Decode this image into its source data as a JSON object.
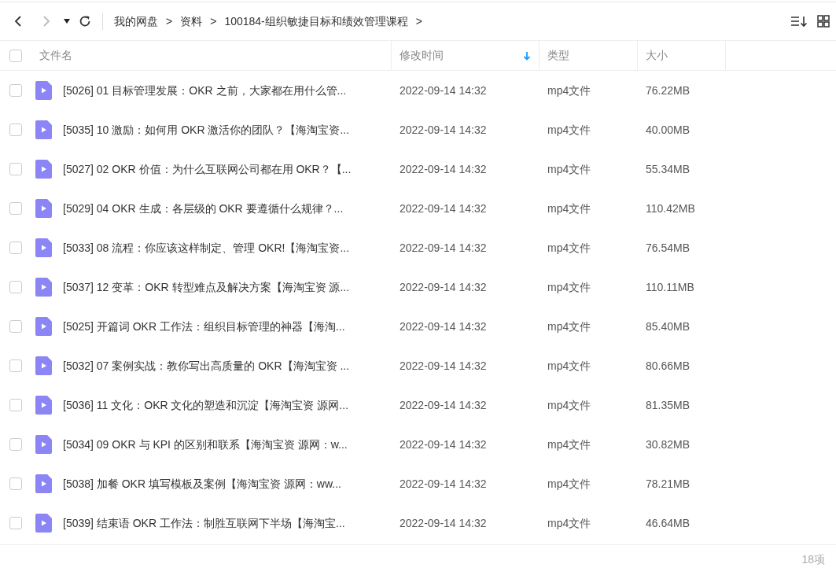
{
  "toolbar": {
    "breadcrumb": [
      "我的网盘",
      "资料",
      "100184-组织敏捷目标和绩效管理课程"
    ],
    "separator": ">"
  },
  "table": {
    "select_all": {
      "checked": false
    },
    "columns": [
      {
        "label": "文件名",
        "sorted": false
      },
      {
        "label": "修改时间",
        "sorted": true
      },
      {
        "label": "类型",
        "sorted": false
      },
      {
        "label": "大小",
        "sorted": false
      }
    ],
    "rows": [
      {
        "checked": false,
        "name": "[5026] 01  目标管理发展：OKR 之前，大家都在用什么管...",
        "modified": "2022-09-14 14:32",
        "type": "mp4文件",
        "size": "76.22MB"
      },
      {
        "checked": false,
        "name": "[5035] 10  激励：如何用 OKR 激活你的团队？【海淘宝资...",
        "modified": "2022-09-14 14:32",
        "type": "mp4文件",
        "size": "40.00MB"
      },
      {
        "checked": false,
        "name": "[5027] 02  OKR 价值：为什么互联网公司都在用 OKR？【...",
        "modified": "2022-09-14 14:32",
        "type": "mp4文件",
        "size": "55.34MB"
      },
      {
        "checked": false,
        "name": "[5029] 04  OKR 生成：各层级的 OKR 要遵循什么规律？...",
        "modified": "2022-09-14 14:32",
        "type": "mp4文件",
        "size": "110.42MB"
      },
      {
        "checked": false,
        "name": "[5033] 08  流程：你应该这样制定、管理 OKR!【海淘宝资...",
        "modified": "2022-09-14 14:32",
        "type": "mp4文件",
        "size": "76.54MB"
      },
      {
        "checked": false,
        "name": "[5037] 12  变革：OKR 转型难点及解决方案【海淘宝资 源...",
        "modified": "2022-09-14 14:32",
        "type": "mp4文件",
        "size": "110.11MB"
      },
      {
        "checked": false,
        "name": "[5025] 开篇词  OKR 工作法：组织目标管理的神器【海淘...",
        "modified": "2022-09-14 14:32",
        "type": "mp4文件",
        "size": "85.40MB"
      },
      {
        "checked": false,
        "name": "[5032] 07  案例实战：教你写出高质量的 OKR【海淘宝资 ...",
        "modified": "2022-09-14 14:32",
        "type": "mp4文件",
        "size": "80.66MB"
      },
      {
        "checked": false,
        "name": "[5036] 11  文化：OKR 文化的塑造和沉淀【海淘宝资 源网...",
        "modified": "2022-09-14 14:32",
        "type": "mp4文件",
        "size": "81.35MB"
      },
      {
        "checked": false,
        "name": "[5034] 09  OKR 与 KPI 的区别和联系【海淘宝资 源网：w...",
        "modified": "2022-09-14 14:32",
        "type": "mp4文件",
        "size": "30.82MB"
      },
      {
        "checked": false,
        "name": "[5038] 加餐  OKR 填写模板及案例【海淘宝资 源网：ww...",
        "modified": "2022-09-14 14:32",
        "type": "mp4文件",
        "size": "78.21MB"
      },
      {
        "checked": false,
        "name": "[5039] 结束语  OKR 工作法：制胜互联网下半场【海淘宝...",
        "modified": "2022-09-14 14:32",
        "type": "mp4文件",
        "size": "46.64MB"
      }
    ]
  },
  "status_bar": {
    "count": "18项"
  }
}
